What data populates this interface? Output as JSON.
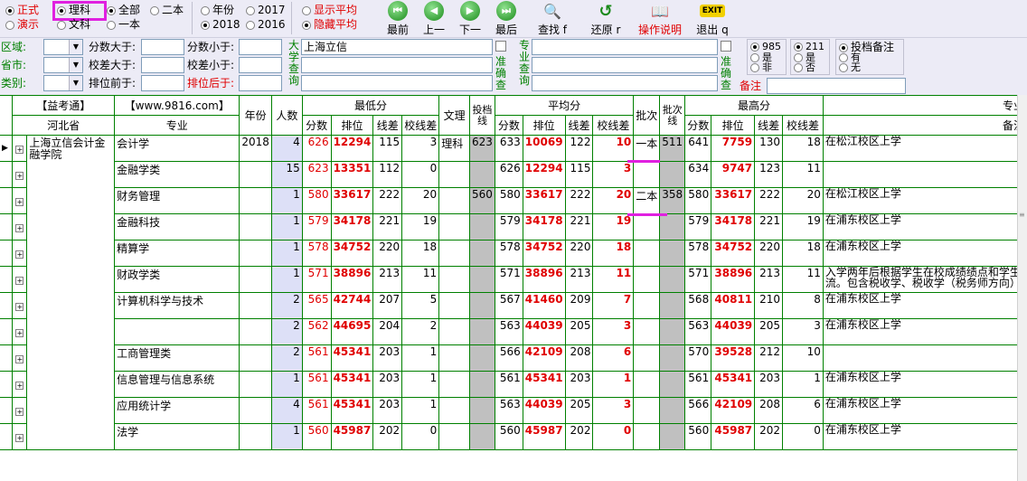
{
  "toolbar": {
    "mode": [
      {
        "label": "正式",
        "on": true
      },
      {
        "label": "演示",
        "on": false
      }
    ],
    "subject": [
      {
        "label": "理科",
        "on": true
      },
      {
        "label": "文科",
        "on": false
      }
    ],
    "scope": [
      {
        "label": "全部",
        "on": true
      },
      {
        "label": "二本",
        "on": false
      },
      {
        "label": "一本",
        "on": false
      }
    ],
    "year_mode": {
      "label": "年份",
      "on": false
    },
    "years": [
      {
        "label": "2017",
        "on": false
      },
      {
        "label": "2018",
        "on": true
      },
      {
        "label": "2016",
        "on": false
      }
    ],
    "avg": [
      {
        "label": "显示平均",
        "on": false
      },
      {
        "label": "隐藏平均",
        "on": true
      }
    ],
    "buttons": [
      {
        "label": "最前",
        "icon": "first-icon",
        "glyph": "⏮"
      },
      {
        "label": "上一",
        "icon": "previous-icon",
        "glyph": "◀"
      },
      {
        "label": "下一",
        "icon": "next-icon",
        "glyph": "▶"
      },
      {
        "label": "最后",
        "icon": "last-icon",
        "glyph": "⏭"
      },
      {
        "label": "查找 f",
        "icon": "search-icon",
        "glyph": "🔍"
      },
      {
        "label": "还原 r",
        "icon": "restore-icon",
        "glyph": "↺"
      },
      {
        "label": "操作说明",
        "icon": "help-icon",
        "glyph": "📖"
      },
      {
        "label": "退出 q",
        "icon": "exit-icon",
        "glyph": "EXIT"
      }
    ]
  },
  "filters": {
    "region": "区域:",
    "province": "省市:",
    "category": "类别:",
    "score_gt": "分数大于:",
    "score_lt": "分数小于:",
    "diff_gt": "校差大于:",
    "diff_lt": "校差小于:",
    "rank_before": "排位前于:",
    "rank_after": "排位后于:",
    "univ_query": "大学查询",
    "univ_value": "上海立信",
    "exact": "准确查",
    "major_query": "专业查询",
    "note": "备注",
    "r985": [
      {
        "label": "985",
        "on": true
      },
      {
        "label": "是",
        "on": false
      },
      {
        "label": "非",
        "on": false
      }
    ],
    "r211": [
      {
        "label": "211",
        "on": true
      },
      {
        "label": "是",
        "on": false
      },
      {
        "label": "否",
        "on": false
      }
    ],
    "rnote": [
      {
        "label": "投档备注",
        "on": true
      },
      {
        "label": "有",
        "on": false
      },
      {
        "label": "无",
        "on": false
      }
    ]
  },
  "table": {
    "h": {
      "yikao": "【益考通】",
      "site": "【www.9816.com】",
      "year": "年份",
      "count": "人数",
      "min": "最低分",
      "wenli": "文理",
      "toudang": "投档线",
      "avg": "平均分",
      "batch": "批次",
      "batchline": "批次线",
      "max": "最高分",
      "major": "专业",
      "note": "备注",
      "province": "河北省",
      "major2": "专业",
      "score": "分数",
      "rank": "排位",
      "line_diff": "线差",
      "school_diff": "校线差"
    },
    "school": "上海立信会计金融学院",
    "rows": [
      {
        "major": "会计学",
        "year": "2018",
        "count": "4",
        "min": "626",
        "minrank": "12294",
        "mline": "115",
        "mschool": "3",
        "wenli": "理科",
        "td": "623",
        "avg": "633",
        "avgrank": "10069",
        "aline": "122",
        "aschool": "10",
        "batch": "一本",
        "bline": "511",
        "max": "641",
        "maxrank": "7759",
        "xline": "130",
        "xschool": "18",
        "note": "在松江校区上学"
      },
      {
        "major": "金融学类",
        "year": "",
        "count": "15",
        "min": "623",
        "minrank": "13351",
        "mline": "112",
        "mschool": "0",
        "wenli": "",
        "td": "",
        "avg": "626",
        "avgrank": "12294",
        "aline": "115",
        "aschool": "3",
        "batch": "",
        "bline": "",
        "max": "634",
        "maxrank": "9747",
        "xline": "123",
        "xschool": "11",
        "note": ""
      },
      {
        "major": "财务管理",
        "year": "",
        "count": "1",
        "min": "580",
        "minrank": "33617",
        "mline": "222",
        "mschool": "20",
        "wenli": "",
        "td": "560",
        "avg": "580",
        "avgrank": "33617",
        "aline": "222",
        "aschool": "20",
        "batch": "二本",
        "bline": "358",
        "max": "580",
        "maxrank": "33617",
        "xline": "222",
        "xschool": "20",
        "note": "在松江校区上学"
      },
      {
        "major": "金融科技",
        "year": "",
        "count": "1",
        "min": "579",
        "minrank": "34178",
        "mline": "221",
        "mschool": "19",
        "wenli": "",
        "td": "",
        "avg": "579",
        "avgrank": "34178",
        "aline": "221",
        "aschool": "19",
        "batch": "",
        "bline": "",
        "max": "579",
        "maxrank": "34178",
        "xline": "221",
        "xschool": "19",
        "note": "在浦东校区上学"
      },
      {
        "major": "精算学",
        "year": "",
        "count": "1",
        "min": "578",
        "minrank": "34752",
        "mline": "220",
        "mschool": "18",
        "wenli": "",
        "td": "",
        "avg": "578",
        "avgrank": "34752",
        "aline": "220",
        "aschool": "18",
        "batch": "",
        "bline": "",
        "max": "578",
        "maxrank": "34752",
        "xline": "220",
        "xschool": "18",
        "note": "在浦东校区上学"
      },
      {
        "major": "财政学类",
        "year": "",
        "count": "1",
        "min": "571",
        "minrank": "38896",
        "mline": "213",
        "mschool": "11",
        "wenli": "",
        "td": "",
        "avg": "571",
        "avgrank": "38896",
        "aline": "213",
        "aschool": "11",
        "batch": "",
        "bline": "",
        "max": "571",
        "maxrank": "38896",
        "xline": "213",
        "xschool": "11",
        "note": "入学两年后根据学生在校成绩绩点和学生流。包含税收学、税收学（税务师方向）"
      },
      {
        "major": "计算机科学与技术",
        "year": "",
        "count": "2",
        "min": "565",
        "minrank": "42744",
        "mline": "207",
        "mschool": "5",
        "wenli": "",
        "td": "",
        "avg": "567",
        "avgrank": "41460",
        "aline": "209",
        "aschool": "7",
        "batch": "",
        "bline": "",
        "max": "568",
        "maxrank": "40811",
        "xline": "210",
        "xschool": "8",
        "note": "在浦东校区上学"
      },
      {
        "major": "",
        "year": "",
        "count": "2",
        "min": "562",
        "minrank": "44695",
        "mline": "204",
        "mschool": "2",
        "wenli": "",
        "td": "",
        "avg": "563",
        "avgrank": "44039",
        "aline": "205",
        "aschool": "3",
        "batch": "",
        "bline": "",
        "max": "563",
        "maxrank": "44039",
        "xline": "205",
        "xschool": "3",
        "note": "在浦东校区上学"
      },
      {
        "major": "工商管理类",
        "year": "",
        "count": "2",
        "min": "561",
        "minrank": "45341",
        "mline": "203",
        "mschool": "1",
        "wenli": "",
        "td": "",
        "avg": "566",
        "avgrank": "42109",
        "aline": "208",
        "aschool": "6",
        "batch": "",
        "bline": "",
        "max": "570",
        "maxrank": "39528",
        "xline": "212",
        "xschool": "10",
        "note": ""
      },
      {
        "major": "信息管理与信息系统",
        "year": "",
        "count": "1",
        "min": "561",
        "minrank": "45341",
        "mline": "203",
        "mschool": "1",
        "wenli": "",
        "td": "",
        "avg": "561",
        "avgrank": "45341",
        "aline": "203",
        "aschool": "1",
        "batch": "",
        "bline": "",
        "max": "561",
        "maxrank": "45341",
        "xline": "203",
        "xschool": "1",
        "note": "在浦东校区上学"
      },
      {
        "major": "应用统计学",
        "year": "",
        "count": "4",
        "min": "561",
        "minrank": "45341",
        "mline": "203",
        "mschool": "1",
        "wenli": "",
        "td": "",
        "avg": "563",
        "avgrank": "44039",
        "aline": "205",
        "aschool": "3",
        "batch": "",
        "bline": "",
        "max": "566",
        "maxrank": "42109",
        "xline": "208",
        "xschool": "6",
        "note": "在浦东校区上学"
      },
      {
        "major": "法学",
        "year": "",
        "count": "1",
        "min": "560",
        "minrank": "45987",
        "mline": "202",
        "mschool": "0",
        "wenli": "",
        "td": "",
        "avg": "560",
        "avgrank": "45987",
        "aline": "202",
        "aschool": "0",
        "batch": "",
        "bline": "",
        "max": "560",
        "maxrank": "45987",
        "xline": "202",
        "xschool": "0",
        "note": "在浦东校区上学"
      }
    ]
  }
}
